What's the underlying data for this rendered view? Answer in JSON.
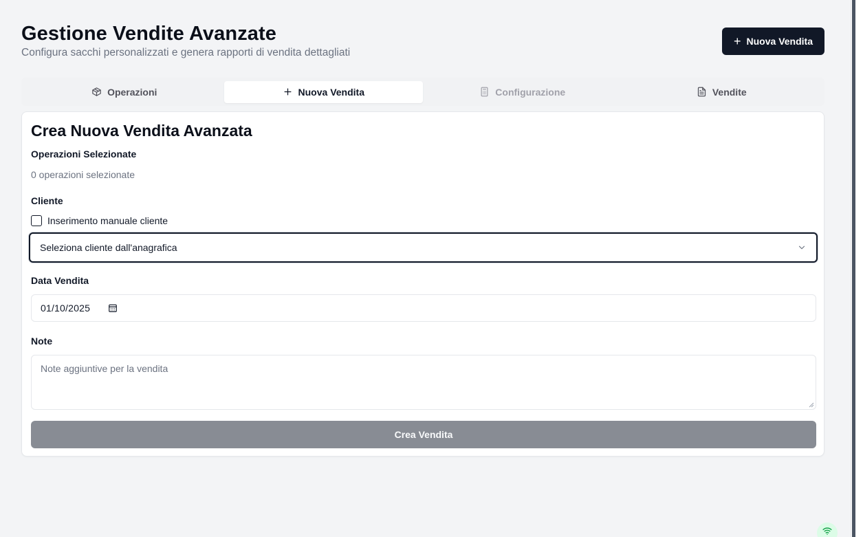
{
  "header": {
    "title": "Gestione Vendite Avanzate",
    "subtitle": "Configura sacchi personalizzati e genera rapporti di vendita dettagliati",
    "new_sale_button": "Nuova Vendita"
  },
  "tabs": [
    {
      "label": "Operazioni",
      "icon": "package-icon",
      "state": "default"
    },
    {
      "label": "Nuova Vendita",
      "icon": "plus-icon",
      "state": "active"
    },
    {
      "label": "Configurazione",
      "icon": "calculator-icon",
      "state": "disabled"
    },
    {
      "label": "Vendite",
      "icon": "file-text-icon",
      "state": "default"
    }
  ],
  "form": {
    "title": "Crea Nuova Vendita Avanzata",
    "operations_label": "Operazioni Selezionate",
    "operations_count": "0 operazioni selezionate",
    "client_label": "Cliente",
    "manual_client_label": "Inserimento manuale cliente",
    "manual_client_checked": false,
    "client_select_placeholder": "Seleziona cliente dall'anagrafica",
    "date_label": "Data Vendita",
    "date_value": "01/10/2025",
    "notes_label": "Note",
    "notes_placeholder": "Note aggiuntive per la vendita",
    "submit_label": "Crea Vendita"
  },
  "colors": {
    "primary_button": "#111827",
    "disabled_button": "#888c94",
    "background": "#f3f4f6",
    "wifi_indicator": "#16a34a"
  }
}
